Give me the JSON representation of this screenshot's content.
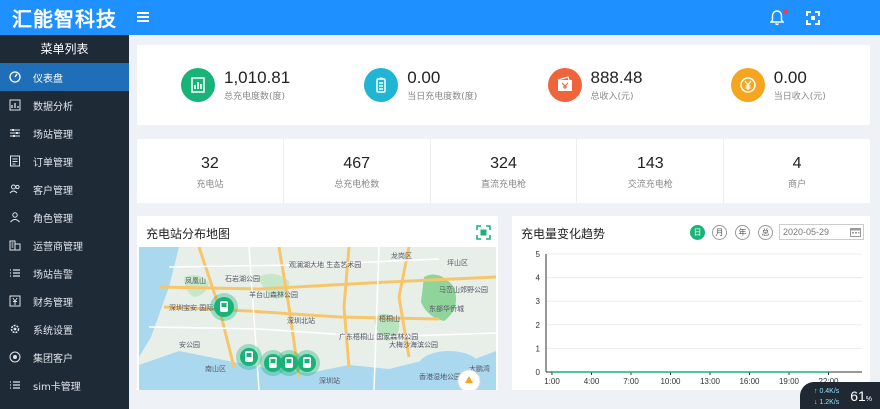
{
  "header": {
    "brand": "汇能智科技",
    "menu_toggle": "≡"
  },
  "sidebar": {
    "title": "菜单列表",
    "items": [
      {
        "label": "仪表盘",
        "icon": "dashboard-icon",
        "active": true
      },
      {
        "label": "数据分析",
        "icon": "chart-icon"
      },
      {
        "label": "场站管理",
        "icon": "sliders-icon"
      },
      {
        "label": "订单管理",
        "icon": "order-icon"
      },
      {
        "label": "客户管理",
        "icon": "users-icon"
      },
      {
        "label": "角色管理",
        "icon": "role-icon"
      },
      {
        "label": "运营商管理",
        "icon": "building-icon"
      },
      {
        "label": "场站告警",
        "icon": "list-icon"
      },
      {
        "label": "财务管理",
        "icon": "finance-icon"
      },
      {
        "label": "系统设置",
        "icon": "gear-icon"
      },
      {
        "label": "集团客户",
        "icon": "group-icon"
      },
      {
        "label": "sim卡管理",
        "icon": "list-icon"
      }
    ]
  },
  "stats_top": [
    {
      "value": "1,010.81",
      "label": "总充电度数(度)",
      "color": "#19b37a",
      "icon": "bar-chart-icon"
    },
    {
      "value": "0.00",
      "label": "当日充电度数(度)",
      "color": "#1fb5d3",
      "icon": "battery-icon"
    },
    {
      "value": "888.48",
      "label": "总收入(元)",
      "color": "#f0643c",
      "icon": "wallet-icon"
    },
    {
      "value": "0.00",
      "label": "当日收入(元)",
      "color": "#f5a51e",
      "icon": "yen-icon"
    }
  ],
  "stats_bottom": [
    {
      "value": "32",
      "label": "充电站"
    },
    {
      "value": "467",
      "label": "总充电枪数"
    },
    {
      "value": "324",
      "label": "直流充电枪"
    },
    {
      "value": "143",
      "label": "交流充电枪"
    },
    {
      "value": "4",
      "label": "商户"
    }
  ],
  "map_panel": {
    "title": "充电站分布地图",
    "place_labels": [
      "龙岗区",
      "坪山区",
      "石岩湖公园",
      "观澜湖大地 生态艺术园",
      "深圳宝安 国际机场",
      "羊台山森林公园",
      "深圳北站",
      "马峦山郊野公园",
      "梧桐山",
      "东部华侨城",
      "广东梧桐山 国家森林公园",
      "大梅沙海滨公园",
      "南山区",
      "深圳站",
      "凤凰山",
      "安公园",
      "香港湿地公园",
      "大鹏湾"
    ]
  },
  "chart_panel": {
    "title": "充电量变化趋势",
    "periods": [
      "日",
      "月",
      "年",
      "总"
    ],
    "active_period": "日",
    "date": "2020-05-29"
  },
  "chart_data": {
    "type": "line",
    "title": "充电量变化趋势",
    "x": [
      "1:00",
      "4:00",
      "7:00",
      "10:00",
      "13:00",
      "16:00",
      "19:00",
      "22:00"
    ],
    "series": [
      {
        "values": [
          0,
          0,
          0,
          0,
          0,
          0,
          0,
          0
        ]
      }
    ],
    "ylim": [
      0,
      5
    ],
    "yticks": [
      "0",
      "1",
      "2",
      "3",
      "4",
      "5"
    ],
    "grid": true
  },
  "speed_widget": {
    "up": "0.4K/s",
    "down": "1.2K/s",
    "percent": "61"
  }
}
